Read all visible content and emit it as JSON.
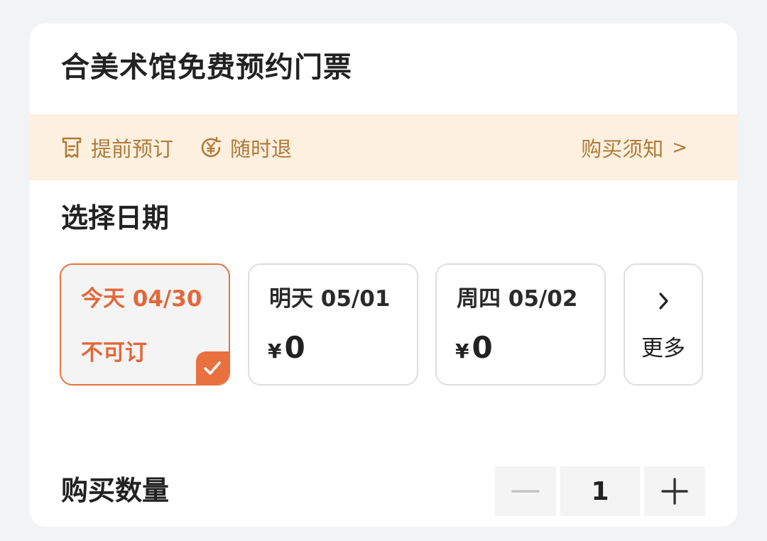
{
  "ticket": {
    "title": "合美术馆免费预约门票"
  },
  "features": {
    "advance_booking": "提前预订",
    "refund_anytime": "随时退",
    "notice": "购买须知",
    "notice_chevron": ">"
  },
  "date_section": {
    "title": "选择日期",
    "options": [
      {
        "label": "今天 04/30",
        "status": "不可订",
        "selected": true
      },
      {
        "label": "明天 05/01",
        "currency": "¥",
        "price": "0"
      },
      {
        "label": "周四 05/02",
        "currency": "¥",
        "price": "0"
      }
    ],
    "more_label": "更多"
  },
  "quantity": {
    "title": "购买数量",
    "value": "1"
  },
  "colors": {
    "accent": "#e8713f",
    "banner_bg": "#fdf0df",
    "banner_text": "#b07a38"
  },
  "icons": {
    "advance_booking": "receipt-icon",
    "refund_anytime": "yen-circle-icon",
    "notice": "chevron-right-icon",
    "selected": "checkmark-icon",
    "more": "chevron-right-icon",
    "decrement": "minus-icon",
    "increment": "plus-icon"
  }
}
